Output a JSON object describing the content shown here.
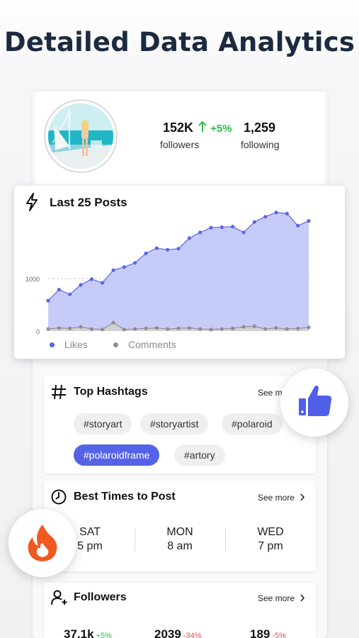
{
  "headline": "Detailed Data Analytics",
  "profile": {
    "followers_value": "152K",
    "followers_growth": "+5%",
    "followers_label": "followers",
    "following_value": "1,259",
    "following_label": "following"
  },
  "posts_chart": {
    "title": "Last 25 Posts",
    "legend_likes": "Likes",
    "legend_comments": "Comments"
  },
  "chart_data": {
    "type": "area",
    "title": "Last 25 Posts",
    "x": [
      1,
      2,
      3,
      4,
      5,
      6,
      7,
      8,
      9,
      10,
      11,
      12,
      13,
      14,
      15,
      16,
      17,
      18,
      19,
      20,
      21,
      22,
      23,
      24,
      25
    ],
    "yticks": [
      0,
      1000
    ],
    "ylim": [
      0,
      2200
    ],
    "grid": "dashed line at 1000",
    "legend": "bottom-left",
    "series": [
      {
        "name": "Likes",
        "color": "#5b67e6",
        "fill": "#c7cbf8",
        "values": [
          580,
          790,
          700,
          880,
          990,
          920,
          1160,
          1220,
          1300,
          1480,
          1580,
          1550,
          1570,
          1770,
          1880,
          1970,
          1980,
          1990,
          1880,
          2080,
          2180,
          2260,
          2240,
          2010,
          2100
        ]
      },
      {
        "name": "Comments",
        "color": "#8d8d8d",
        "fill": "#d0d0d4",
        "values": [
          40,
          60,
          50,
          80,
          40,
          30,
          160,
          30,
          40,
          50,
          60,
          40,
          50,
          60,
          40,
          30,
          40,
          50,
          80,
          90,
          40,
          60,
          40,
          50,
          70
        ]
      }
    ]
  },
  "hashtags": {
    "title": "Top Hashtags",
    "see_more": "See mo",
    "tags": [
      "#storyart",
      "#storyartist",
      "#polaroid",
      "#polaroidframe",
      "#artory"
    ]
  },
  "best_times": {
    "title": "Best Times to Post",
    "see_more": "See more",
    "slots": [
      {
        "day": "SAT",
        "time": "5 pm"
      },
      {
        "day": "MON",
        "time": "8 am"
      },
      {
        "day": "WED",
        "time": "7 pm"
      }
    ]
  },
  "followers": {
    "title": "Followers",
    "see_more": "See more",
    "stats": [
      {
        "value": "37.1k",
        "pct": "+5%"
      },
      {
        "value": "2039",
        "pct": "-34%"
      },
      {
        "value": "189",
        "pct": "-5%"
      }
    ]
  },
  "colors": {
    "accent": "#5463e8",
    "positive": "#2cbf4a",
    "negative": "#e34b4b",
    "headline": "#1c2a3f"
  },
  "icons": [
    "arrow-up-icon",
    "lightning-icon",
    "hashtag-icon",
    "clock-icon",
    "user-plus-icon",
    "chevron-right-icon",
    "thumbs-up-icon",
    "fire-icon"
  ]
}
